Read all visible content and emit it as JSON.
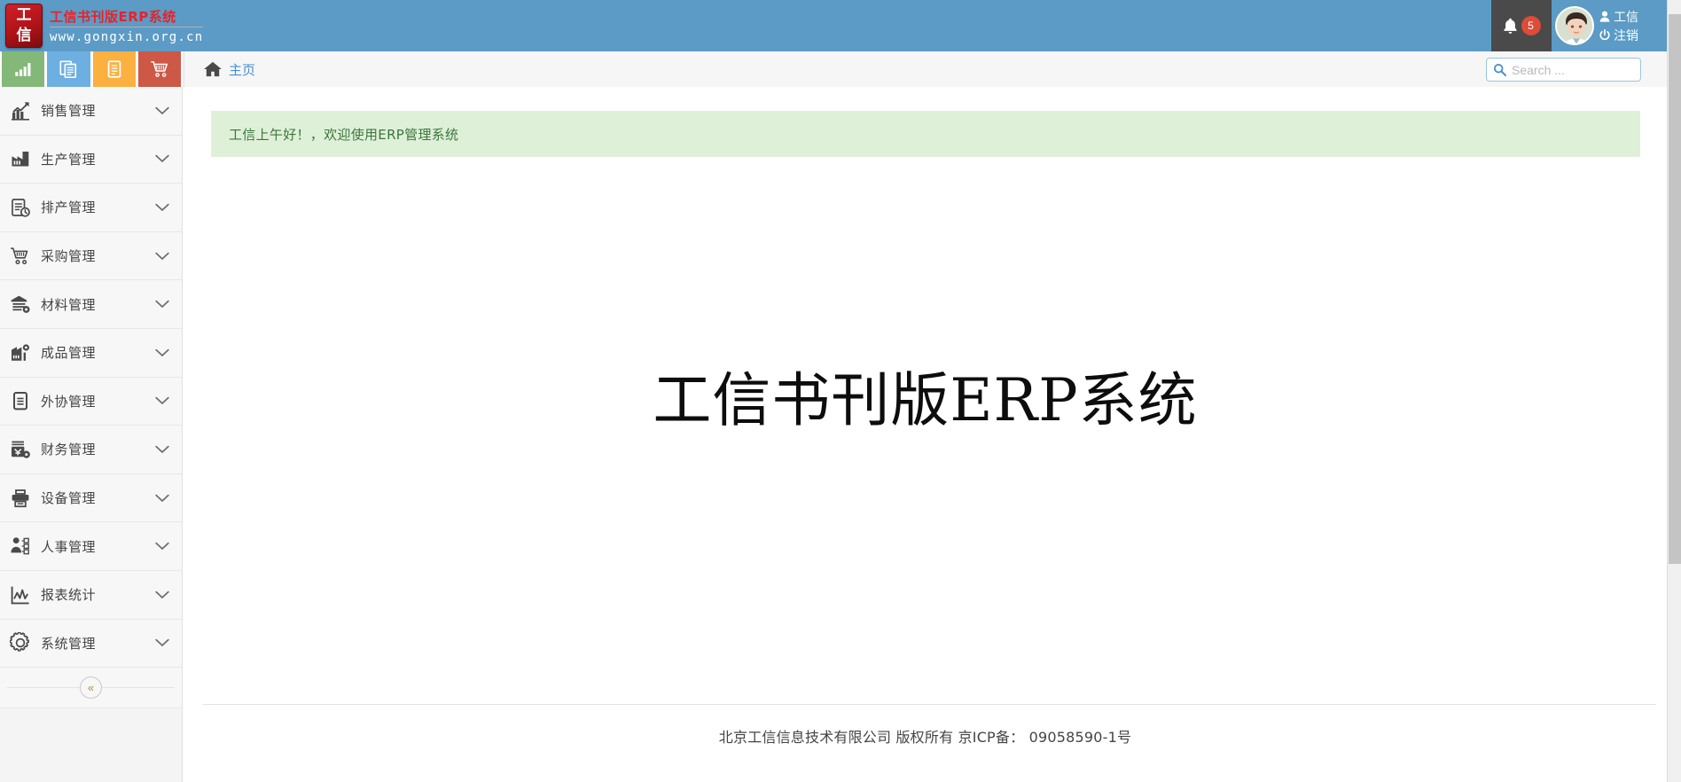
{
  "header": {
    "logo_text_top": "工",
    "logo_text_bottom": "信",
    "brand_title": "工信书刊版ERP系统",
    "brand_url": "www.gongxin.org.cn",
    "notification_count": "5",
    "user_name": "工信",
    "logout_label": "注销"
  },
  "quick_tiles": [
    {
      "name": "chart-tile",
      "color": "#83b878",
      "icon": "bar-chart-icon"
    },
    {
      "name": "documents-tile",
      "color": "#6dafe0",
      "icon": "copy-documents-icon"
    },
    {
      "name": "document-tile",
      "color": "#fcb040",
      "icon": "document-icon"
    },
    {
      "name": "cart-tile",
      "color": "#cc5845",
      "icon": "shopping-cart-icon"
    }
  ],
  "breadcrumb": {
    "home_label": "主页"
  },
  "search": {
    "placeholder": "Search ...",
    "value": ""
  },
  "sidebar": {
    "items": [
      {
        "label": "销售管理",
        "icon": "sales-chart-icon"
      },
      {
        "label": "生产管理",
        "icon": "factory-icon"
      },
      {
        "label": "排产管理",
        "icon": "schedule-clock-icon"
      },
      {
        "label": "采购管理",
        "icon": "purchase-cart-icon"
      },
      {
        "label": "材料管理",
        "icon": "warehouse-gear-icon"
      },
      {
        "label": "成品管理",
        "icon": "finished-goods-icon"
      },
      {
        "label": "外协管理",
        "icon": "clipboard-icon"
      },
      {
        "label": "财务管理",
        "icon": "finance-gear-icon"
      },
      {
        "label": "设备管理",
        "icon": "printer-icon"
      },
      {
        "label": "人事管理",
        "icon": "personnel-icon"
      },
      {
        "label": "报表统计",
        "icon": "report-statistics-icon"
      },
      {
        "label": "系统管理",
        "icon": "gear-icon"
      }
    ],
    "collapse_label": "«"
  },
  "main": {
    "welcome_message": "工信上午好！，欢迎使用ERP管理系统",
    "hero_title": "工信书刊版ERP系统",
    "footer_text": "北京工信信息技术有限公司 版权所有 京ICP备： 09058590-1号"
  },
  "colors": {
    "header_blue": "#5b9bc6",
    "notif_dark": "#4a4a4a",
    "badge_red": "#dd4b39",
    "banner_bg": "#dff0d8",
    "banner_text": "#3c763d",
    "link_blue": "#4a8fd0"
  }
}
